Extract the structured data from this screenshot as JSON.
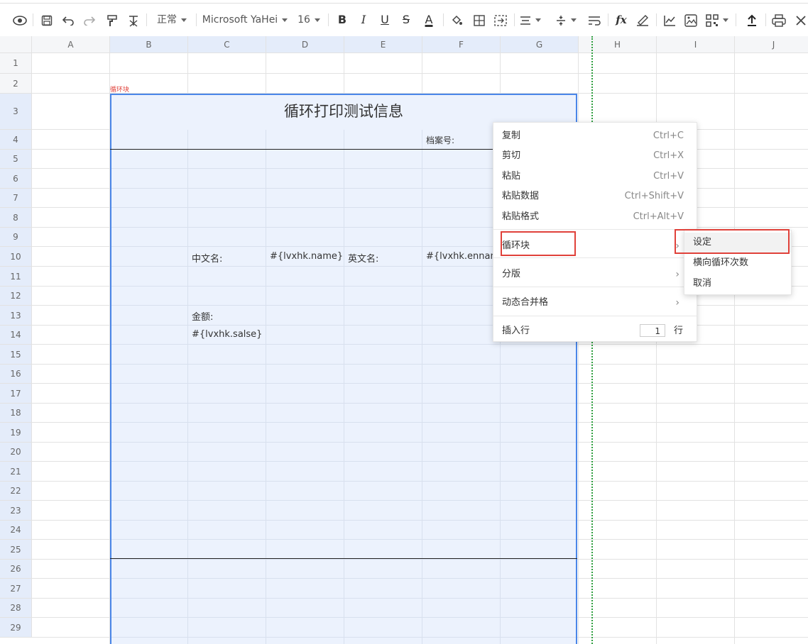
{
  "toolbar": {
    "style_value": "正常",
    "font_value": "Microsoft YaHei",
    "size_value": "16",
    "bold": "B",
    "italic": "I",
    "underline": "U",
    "strike": "S",
    "fontcolor": "A",
    "fx": "fx"
  },
  "columns": [
    "A",
    "B",
    "C",
    "D",
    "E",
    "F",
    "G",
    "H",
    "I",
    "J"
  ],
  "rows": [
    "1",
    "2",
    "3",
    "4",
    "5",
    "6",
    "7",
    "8",
    "9",
    "10",
    "11",
    "12",
    "13",
    "14",
    "15",
    "16",
    "17",
    "18",
    "19",
    "20",
    "21",
    "22",
    "23",
    "24",
    "25",
    "26",
    "27",
    "28",
    "29"
  ],
  "sheet": {
    "loop_tag": "循环块",
    "title": "循环打印测试信息",
    "archive_label": "档案号:",
    "cn_name_label": "中文名:",
    "cn_name_value": "#{lvxhk.name}",
    "en_name_label": "英文名:",
    "en_name_value": "#{lvxhk.ennam",
    "amount_label": "金额:",
    "amount_value": "#{lvxhk.salse}"
  },
  "context_menu": {
    "copy": {
      "label": "复制",
      "shortcut": "Ctrl+C"
    },
    "cut": {
      "label": "剪切",
      "shortcut": "Ctrl+X"
    },
    "paste": {
      "label": "粘贴",
      "shortcut": "Ctrl+V"
    },
    "paste_data": {
      "label": "粘贴数据",
      "shortcut": "Ctrl+Shift+V"
    },
    "paste_format": {
      "label": "粘贴格式",
      "shortcut": "Ctrl+Alt+V"
    },
    "loop_block": {
      "label": "循环块"
    },
    "pagination": {
      "label": "分版"
    },
    "dynamic_merge": {
      "label": "动态合并格"
    },
    "insert_row": {
      "label": "插入行",
      "count": "1",
      "unit": "行"
    }
  },
  "submenu": {
    "set": "设定",
    "horizontal_count": "横向循环次数",
    "cancel": "取消"
  },
  "colors": {
    "selection_fill": "#ecf2fd",
    "selection_border": "#4a86e8",
    "highlight_red": "#e0413a",
    "page_break": "#2e9e3f"
  }
}
